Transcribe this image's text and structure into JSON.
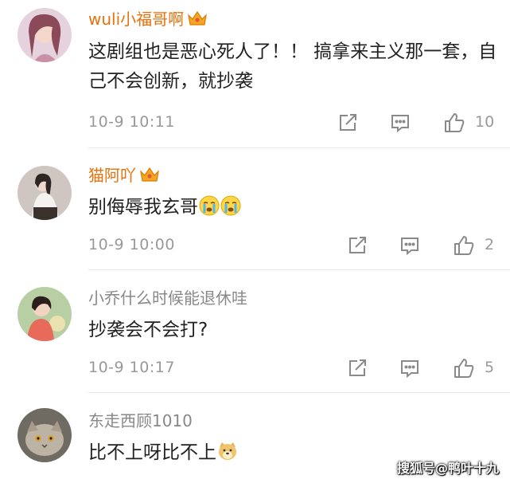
{
  "comments": [
    {
      "username": "wuli小福哥啊",
      "vip": true,
      "text": "这剧组也是恶心死人了！！ 搞拿来主义那一套，自己不会创新，就抄袭",
      "emoji": [],
      "time": "10-9 10:11",
      "likes": "10",
      "avatar_color": "#d8b4c6"
    },
    {
      "username": "猫阿吖",
      "vip": true,
      "text": "别侮辱我玄哥",
      "emoji": [
        "crying-face",
        "crying-face"
      ],
      "time": "10-9 10:00",
      "likes": "2",
      "avatar_color": "#5a4a44"
    },
    {
      "username": "小乔什么时候能退休哇",
      "vip": false,
      "text": "抄袭会不会打?",
      "emoji": [],
      "time": "10-9 10:17",
      "likes": "5",
      "avatar_color": "#9bb58a"
    },
    {
      "username": "东走西顾1010",
      "vip": false,
      "text": "比不上呀比不上",
      "emoji": [
        "doge-face"
      ],
      "time": "",
      "likes": "",
      "avatar_color": "#8a8378"
    }
  ],
  "watermark": "搜狐号@鸭叶十九",
  "colors": {
    "vip_name": "#e8700a",
    "normal_name": "#888888",
    "meta": "#999999"
  },
  "icons": {
    "repost": "share-icon",
    "comment": "comment-icon",
    "like": "thumbs-up-icon",
    "badge": "crown-icon"
  }
}
